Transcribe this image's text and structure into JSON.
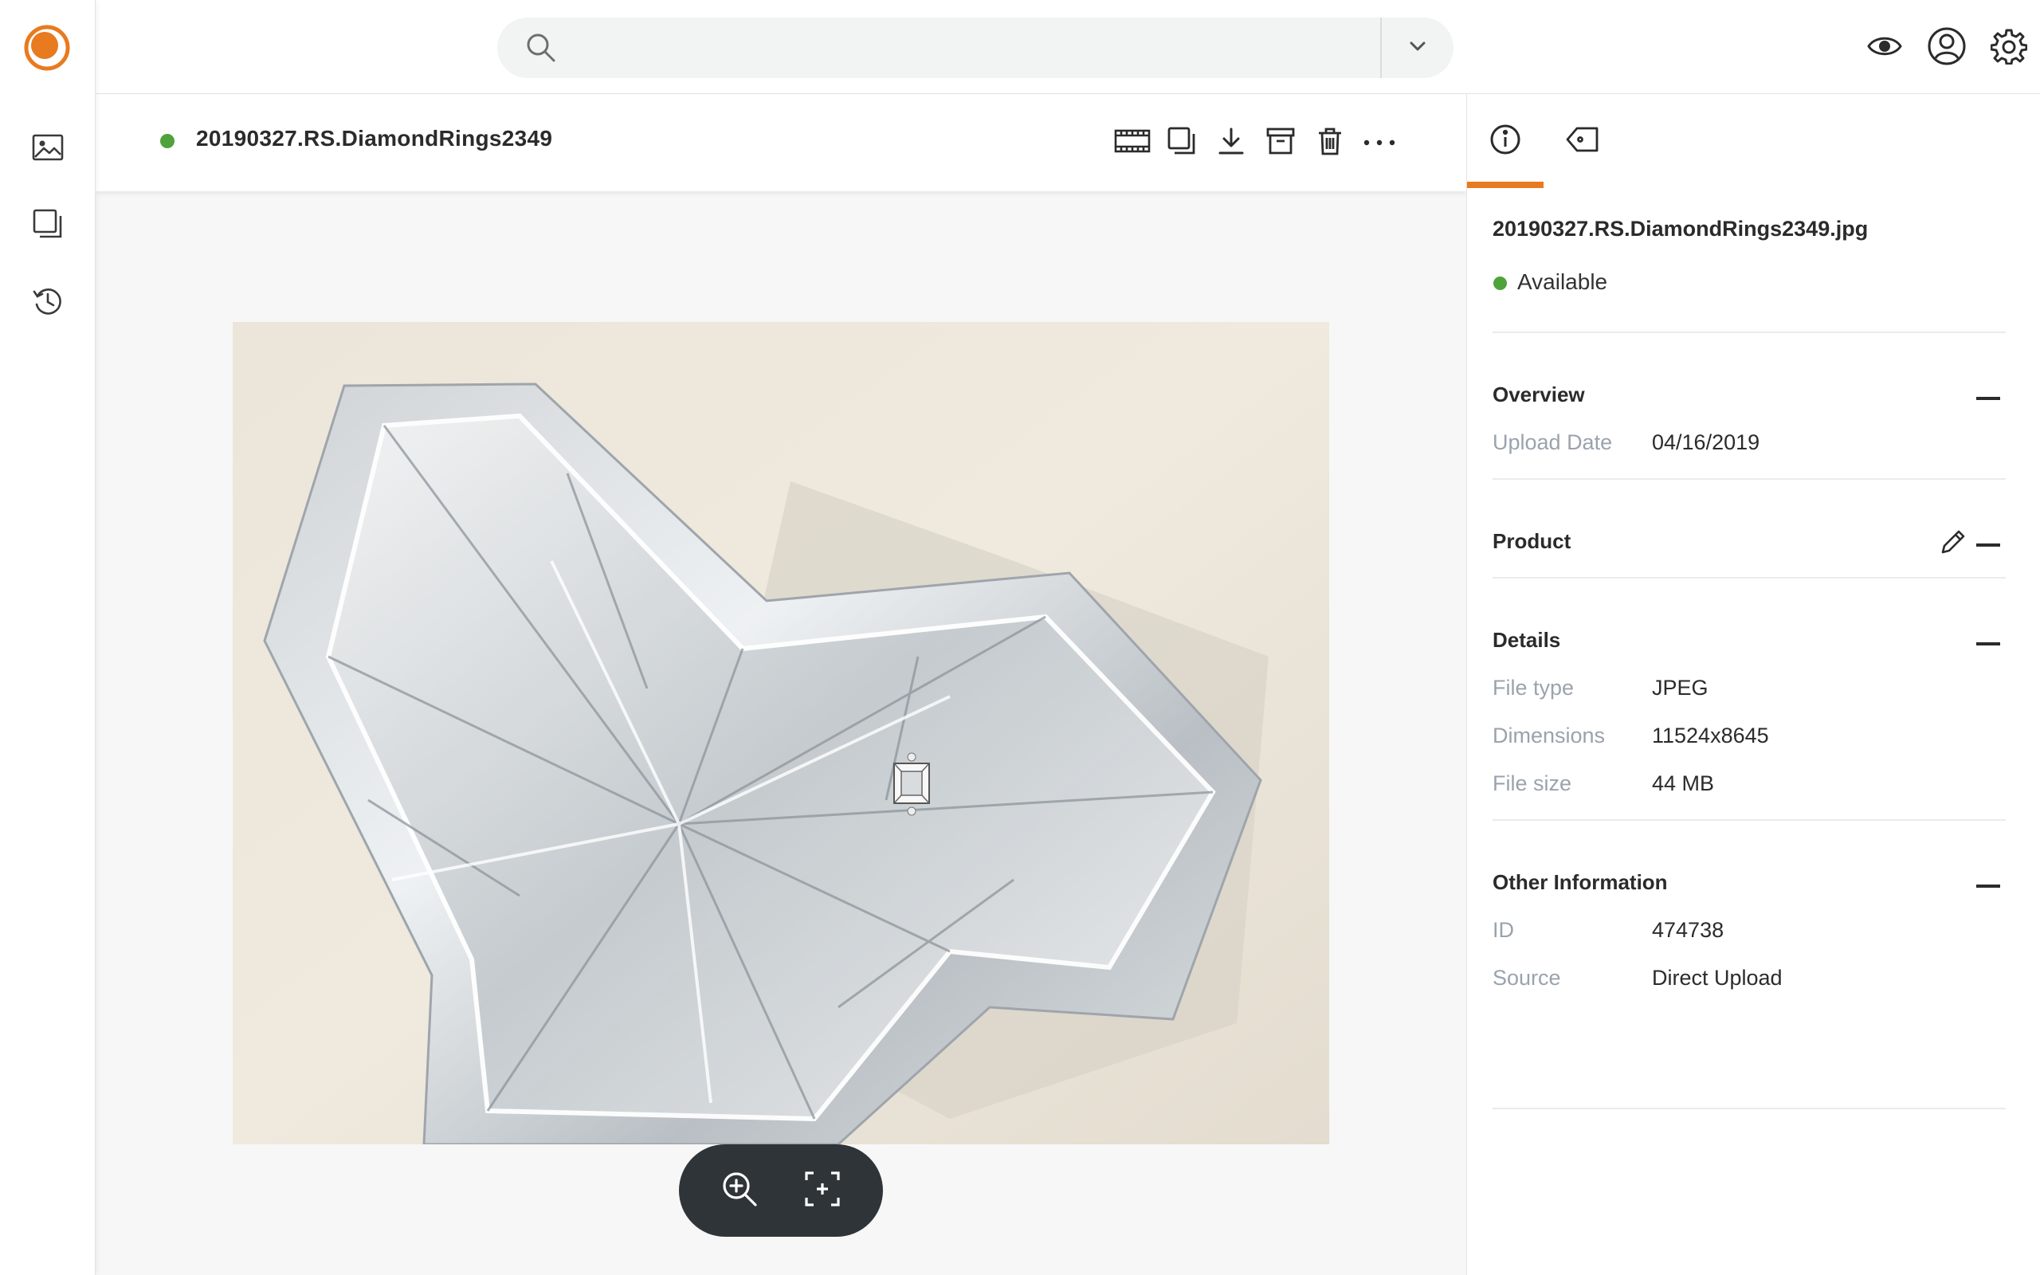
{
  "colors": {
    "accent": "#e87a1f",
    "status_green": "#4fa33a",
    "zoom_bar": "#2f3438"
  },
  "rail": {
    "logo": "app-logo",
    "items": [
      {
        "icon": "image-icon"
      },
      {
        "icon": "collections-icon"
      },
      {
        "icon": "history-icon"
      }
    ]
  },
  "search": {
    "value": "",
    "placeholder": ""
  },
  "header_actions": [
    "eye-icon",
    "user-icon",
    "gear-icon"
  ],
  "asset": {
    "title": "20190327.RS.DiamondRings2349",
    "status_color": "#4fa33a",
    "toolbar": [
      "filmstrip-icon",
      "copy-icon",
      "download-icon",
      "archive-icon",
      "trash-icon",
      "more-icon"
    ]
  },
  "zoom_tools": [
    "zoom-in-icon",
    "fit-screen-icon"
  ],
  "panel": {
    "tabs": [
      "info-icon",
      "tag-icon"
    ],
    "active_tab": 0,
    "filename": "20190327.RS.DiamondRings2349.jpg",
    "availability": "Available",
    "sections": {
      "overview": {
        "title": "Overview",
        "rows": [
          {
            "label": "Upload Date",
            "value": "04/16/2019"
          }
        ]
      },
      "product": {
        "title": "Product"
      },
      "details": {
        "title": "Details",
        "rows": [
          {
            "label": "File type",
            "value": "JPEG"
          },
          {
            "label": "Dimensions",
            "value": "11524x8645"
          },
          {
            "label": "File size",
            "value": "44 MB"
          }
        ]
      },
      "other": {
        "title": "Other Information",
        "rows": [
          {
            "label": "ID",
            "value": "474738"
          },
          {
            "label": "Source",
            "value": "Direct Upload"
          }
        ]
      }
    }
  }
}
